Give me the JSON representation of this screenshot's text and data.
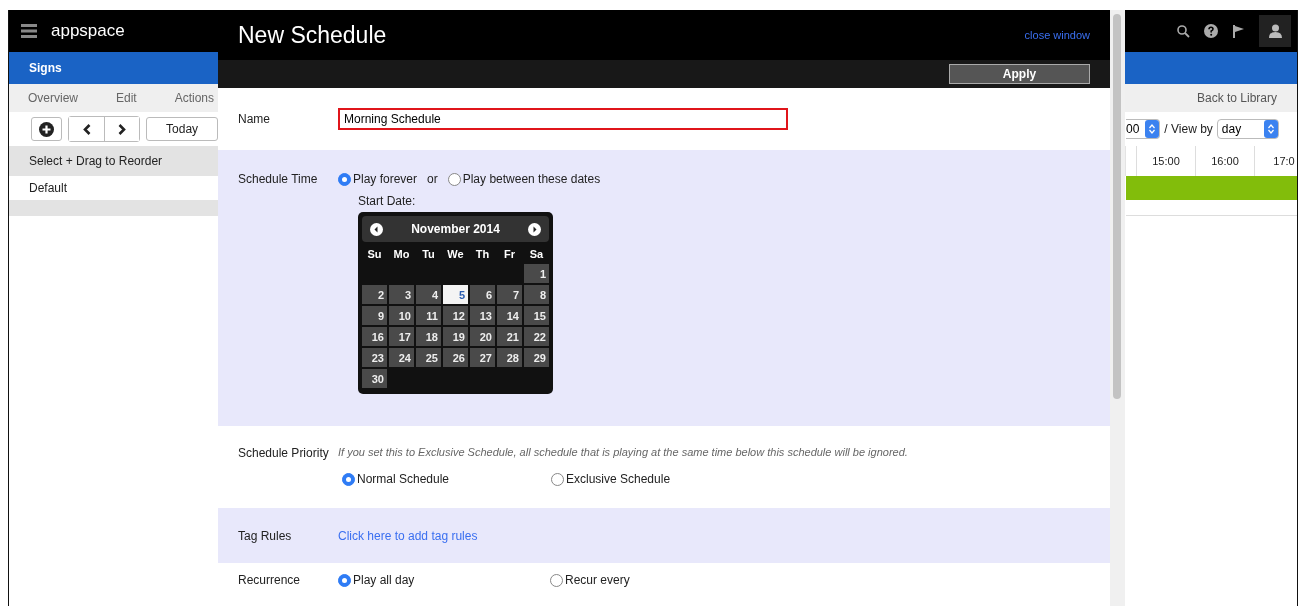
{
  "app": {
    "logo": "appspace",
    "section": "Signs",
    "nav_items": [
      "Overview",
      "Edit",
      "Actions"
    ],
    "today_button": "Today",
    "list_header": "Select + Drag to Reorder",
    "list_items": [
      "Default"
    ],
    "back_link": "Back to Library",
    "time_select": "00",
    "view_by_label": "/ View by",
    "view_select": "day",
    "timeline_hours": [
      "15:00",
      "16:00",
      "17:0"
    ]
  },
  "dialog": {
    "title": "New Schedule",
    "close_link": "close window",
    "apply_button": "Apply",
    "sections": [
      {
        "kind": "text",
        "label": "Name",
        "value": "Morning Schedule",
        "error": true
      },
      {
        "kind": "dates",
        "label": "Schedule Time",
        "separator": "or",
        "options": [
          {
            "label": "Play forever",
            "selected": true
          },
          {
            "label": "Play between these dates",
            "selected": false
          }
        ],
        "calendar": {
          "caption": "Start Date:",
          "month": "November 2014",
          "weekdays": [
            "Su",
            "Mo",
            "Tu",
            "We",
            "Th",
            "Fr",
            "Sa"
          ],
          "weeks": [
            {
              "days": [
                {
                  "label": "1",
                  "selected": false
                }
              ]
            },
            {
              "days": [
                {
                  "label": "2",
                  "selected": false
                },
                {
                  "label": "3",
                  "selected": false
                },
                {
                  "label": "4",
                  "selected": false
                },
                {
                  "label": "5",
                  "selected": true
                },
                {
                  "label": "6",
                  "selected": false
                },
                {
                  "label": "7",
                  "selected": false
                },
                {
                  "label": "8",
                  "selected": false
                }
              ]
            },
            {
              "days": [
                {
                  "label": "9",
                  "selected": false
                },
                {
                  "label": "10",
                  "selected": false
                },
                {
                  "label": "11",
                  "selected": false
                },
                {
                  "label": "12",
                  "selected": false
                },
                {
                  "label": "13",
                  "selected": false
                },
                {
                  "label": "14",
                  "selected": false
                },
                {
                  "label": "15",
                  "selected": false
                }
              ]
            },
            {
              "days": [
                {
                  "label": "16",
                  "selected": false
                },
                {
                  "label": "17",
                  "selected": false
                },
                {
                  "label": "18",
                  "selected": false
                },
                {
                  "label": "19",
                  "selected": false
                },
                {
                  "label": "20",
                  "selected": false
                },
                {
                  "label": "21",
                  "selected": false
                },
                {
                  "label": "22",
                  "selected": false
                }
              ]
            },
            {
              "days": [
                {
                  "label": "23",
                  "selected": false
                },
                {
                  "label": "24",
                  "selected": false
                },
                {
                  "label": "25",
                  "selected": false
                },
                {
                  "label": "26",
                  "selected": false
                },
                {
                  "label": "27",
                  "selected": false
                },
                {
                  "label": "28",
                  "selected": false
                },
                {
                  "label": "29",
                  "selected": false
                }
              ]
            },
            {
              "days": [
                {
                  "label": "30",
                  "selected": false
                }
              ]
            }
          ]
        }
      },
      {
        "kind": "choice",
        "label": "Schedule Priority",
        "note": "If you set this to Exclusive Schedule, all schedule that is playing at the same time below this schedule will be ignored.",
        "options": [
          {
            "label": "Normal Schedule",
            "selected": true
          },
          {
            "label": "Exclusive Schedule",
            "selected": false
          }
        ]
      },
      {
        "kind": "link",
        "label": "Tag Rules",
        "link": "Click here to add tag rules"
      },
      {
        "kind": "choice",
        "label": "Recurrence",
        "options": [
          {
            "label": "Play all day",
            "selected": true
          },
          {
            "label": "Recur every",
            "selected": false
          }
        ]
      }
    ]
  }
}
